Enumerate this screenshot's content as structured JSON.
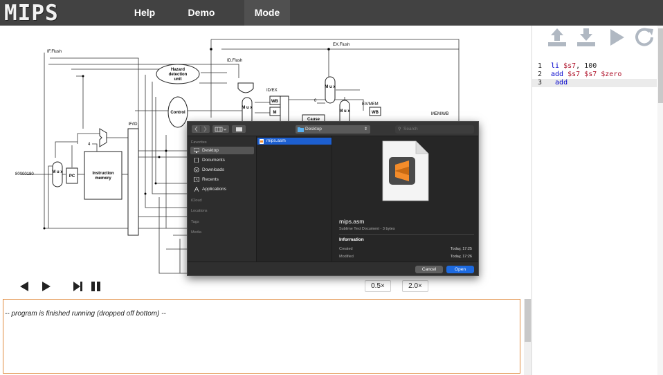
{
  "app": {
    "logo": "MIPS"
  },
  "nav": {
    "help": "Help",
    "demo": "Demo",
    "mode": "Mode"
  },
  "toolbar": {
    "icons": [
      "upload-icon",
      "download-icon",
      "play-icon",
      "refresh-icon"
    ]
  },
  "editor": {
    "lines": [
      {
        "number": "1",
        "op": "li",
        "args": [
          {
            "t": "$s7",
            "k": "reg"
          },
          {
            "t": ", 100",
            "k": "num"
          }
        ]
      },
      {
        "number": "2",
        "op": "add",
        "args": [
          {
            "t": "$s7 $s7 $zero",
            "k": "reg"
          }
        ]
      },
      {
        "number": "3",
        "op": "add",
        "args": []
      }
    ]
  },
  "diagram": {
    "labels": {
      "if_flush": "IF.Flush",
      "id_flush": "ID.Flush",
      "ex_flush": "EX.Flush",
      "hazard": [
        "Hazard",
        "detection",
        "unit"
      ],
      "control": "Control",
      "if_id": "IF/ID",
      "id_ex": "ID/EX",
      "ex_mem": "EX/MEM",
      "mem_wb": "MEM/WB",
      "wb": "WB",
      "m": "M",
      "cause": "Cause",
      "pc": "PC",
      "mux": "M u x",
      "instr_mem": [
        "Instruction",
        "memory"
      ],
      "addr": "80000180",
      "four": "4",
      "zero": "0"
    }
  },
  "controls": {
    "speed_slow": "0.5×",
    "speed_fast": "2.0×"
  },
  "console": {
    "output": "-- program is finished running (dropped off bottom) --"
  },
  "dialog": {
    "location": "Desktop",
    "search_placeholder": "Search",
    "sidebar": {
      "favorites_header": "Favorites",
      "favorites": [
        "Desktop",
        "Documents",
        "Downloads",
        "Recents",
        "Applications"
      ],
      "icloud_header": "iCloud",
      "locations_header": "Locations",
      "tags_header": "Tags",
      "media_header": "Media"
    },
    "file": "mips.asm",
    "preview": {
      "name": "mips.asm",
      "kind": "Sublime Text Document - 3 bytes",
      "info_header": "Information",
      "created_label": "Created",
      "created_value": "Today, 17:25",
      "modified_label": "Modified",
      "modified_value": "Today, 17:26"
    },
    "cancel": "Cancel",
    "open": "Open",
    "colors": {
      "accent": "#1d5fd0",
      "sublime_orange": "#f48c2a"
    }
  }
}
